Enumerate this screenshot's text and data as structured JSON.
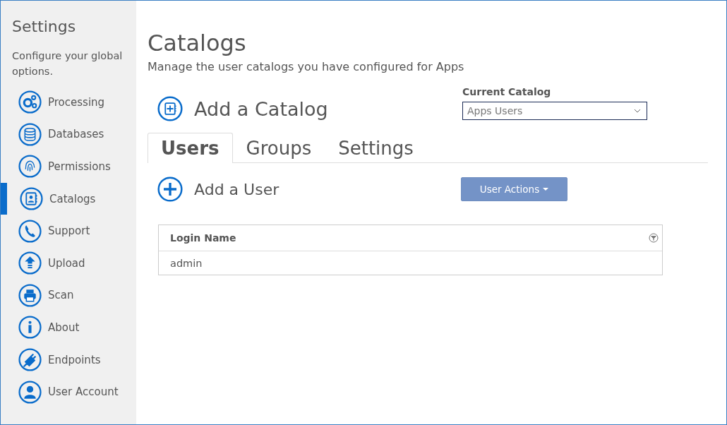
{
  "sidebar": {
    "title": "Settings",
    "description": "Configure your global options.",
    "items": [
      {
        "label": "Processing",
        "selected": false
      },
      {
        "label": "Databases",
        "selected": false
      },
      {
        "label": "Permissions",
        "selected": false
      },
      {
        "label": "Catalogs",
        "selected": true
      },
      {
        "label": "Support",
        "selected": false
      },
      {
        "label": "Upload",
        "selected": false
      },
      {
        "label": "Scan",
        "selected": false
      },
      {
        "label": "About",
        "selected": false
      },
      {
        "label": "Endpoints",
        "selected": false
      },
      {
        "label": "User Account",
        "selected": false
      }
    ]
  },
  "page": {
    "title": "Catalogs",
    "subtitle": "Manage the user catalogs you have configured for Apps"
  },
  "add_catalog": {
    "label": "Add a Catalog"
  },
  "current_catalog": {
    "label": "Current Catalog",
    "value": "Apps Users"
  },
  "tabs": [
    {
      "label": "Users",
      "selected": true
    },
    {
      "label": "Groups",
      "selected": false
    },
    {
      "label": "Settings",
      "selected": false
    }
  ],
  "add_user": {
    "label": "Add a User"
  },
  "user_actions": {
    "label": "User Actions"
  },
  "table": {
    "columns": [
      "Login Name"
    ],
    "rows": [
      [
        "admin"
      ]
    ]
  }
}
